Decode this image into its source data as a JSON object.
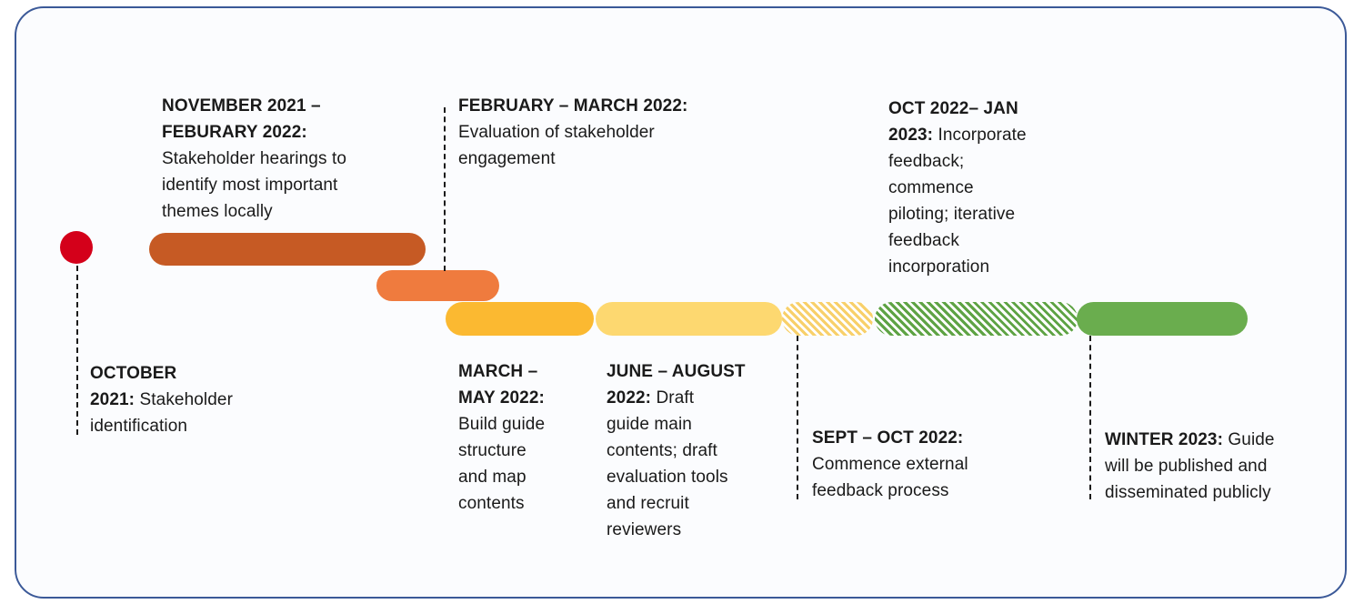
{
  "timeline": {
    "colors": {
      "frame_border": "#3b5998",
      "milestone_dot": "#d4001a",
      "phase_1": "#c65a24",
      "phase_2": "#ef7b3e",
      "phase_3": "#fbb931",
      "phase_4": "#fdd870",
      "phase_5_hatched": "#f8d06a",
      "phase_6_hatched": "#5ea344",
      "phase_7": "#6aad4e"
    },
    "milestones": [
      {
        "id": "oct-2021",
        "date": "OCTOBER 2021:",
        "date_line1": "OCTOBER",
        "date_line2": "2021:",
        "text": "Stakeholder identification",
        "text_line1": "Stakeholder",
        "text_line2": "identification"
      },
      {
        "id": "nov-feb",
        "date_line1": "NOVEMBER 2021 –",
        "date_line2": "FEBURARY 2022:",
        "text_line1": "Stakeholder hearings to",
        "text_line2": "identify most important",
        "text_line3": "themes locally"
      },
      {
        "id": "feb-mar",
        "date": "FEBRUARY – MARCH 2022:",
        "text_line1": "Evaluation of stakeholder",
        "text_line2": "engagement"
      },
      {
        "id": "mar-may",
        "date_line1": "MARCH –",
        "date_line2": "MAY 2022:",
        "text_line1": "Build guide",
        "text_line2": "structure",
        "text_line3": "and map",
        "text_line4": "contents"
      },
      {
        "id": "jun-aug",
        "date_line1": "JUNE – AUGUST",
        "date_line2": "2022:",
        "text_line2": " Draft",
        "text_line3": "guide main",
        "text_line4": "contents; draft",
        "text_line5": "evaluation tools",
        "text_line6": "and recruit",
        "text_line7": "reviewers"
      },
      {
        "id": "sep-oct",
        "date": "SEPT – OCT 2022:",
        "text_line1": "Commence external",
        "text_line2": "feedback process"
      },
      {
        "id": "oct-jan",
        "date_line1": "OCT 2022– JAN",
        "date_line2": "2023:",
        "text_line2": " Incorporate",
        "text_line3": "feedback;",
        "text_line4": "commence",
        "text_line5": "piloting; iterative",
        "text_line6": "feedback",
        "text_line7": "incorporation"
      },
      {
        "id": "winter-2023",
        "date": "WINTER 2023:",
        "text_line1": " Guide",
        "text_line2": "will be published and",
        "text_line3": "disseminated publicly"
      }
    ]
  }
}
